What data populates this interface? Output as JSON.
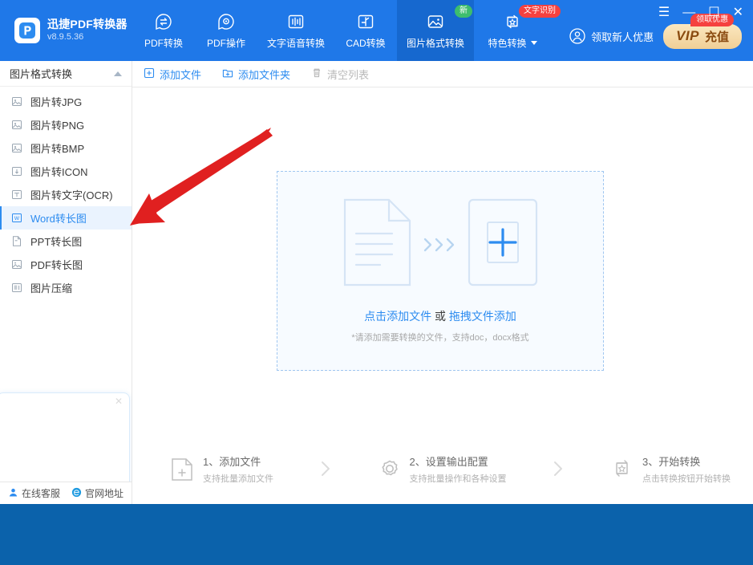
{
  "brand": {
    "title": "迅捷PDF转换器",
    "version": "v8.9.5.36",
    "logo_icon": "p-logo-icon"
  },
  "header": {
    "nav": [
      {
        "label": "PDF转换",
        "icon": "convert-arrows-icon",
        "active": false,
        "badge": null,
        "caret": false
      },
      {
        "label": "PDF操作",
        "icon": "gear-circle-icon",
        "active": false,
        "badge": null,
        "caret": false
      },
      {
        "label": "文字语音转换",
        "icon": "waveform-icon",
        "active": false,
        "badge": null,
        "caret": false
      },
      {
        "label": "CAD转换",
        "icon": "cad-axis-icon",
        "active": false,
        "badge": null,
        "caret": false
      },
      {
        "label": "图片格式转换",
        "icon": "picture-icon",
        "active": true,
        "badge": "新",
        "caret": false
      },
      {
        "label": "特色转换",
        "icon": "star-refresh-icon",
        "active": false,
        "badge": "文字识别",
        "caret": true
      }
    ],
    "promo_label": "领取新人优惠",
    "promo_icon": "user-circle-icon",
    "vip_word": "VIP",
    "vip_label": "充值",
    "vip_badge": "领取优惠",
    "window_controls": {
      "menu": "☰",
      "minimize": "—",
      "maximize": "☐",
      "close": "✕"
    }
  },
  "sidebar": {
    "group_title": "图片格式转换",
    "collapse_icon": "chevron-up-icon",
    "items": [
      {
        "label": "图片转JPG",
        "icon": "image-to-jpg-icon",
        "selected": false
      },
      {
        "label": "图片转PNG",
        "icon": "image-to-png-icon",
        "selected": false
      },
      {
        "label": "图片转BMP",
        "icon": "image-to-bmp-icon",
        "selected": false
      },
      {
        "label": "图片转ICON",
        "icon": "image-to-icon-icon",
        "selected": false
      },
      {
        "label": "图片转文字(OCR)",
        "icon": "text-ocr-icon",
        "selected": false
      },
      {
        "label": "Word转长图",
        "icon": "word-doc-icon",
        "selected": true
      },
      {
        "label": "PPT转长图",
        "icon": "ppt-doc-icon",
        "selected": false
      },
      {
        "label": "PDF转长图",
        "icon": "pdf-image-icon",
        "selected": false
      },
      {
        "label": "图片压缩",
        "icon": "compress-icon",
        "selected": false
      }
    ],
    "promo_card_close": "✕"
  },
  "toolbar": {
    "add_file": "添加文件",
    "add_file_icon": "add-file-icon",
    "add_folder": "添加文件夹",
    "add_folder_icon": "add-folder-icon",
    "clear_list": "清空列表",
    "clear_list_icon": "trash-icon"
  },
  "dropzone": {
    "doc_icon": "document-lines-icon",
    "arrows_icon": "chevrons-right-icon",
    "plus_icon": "plus-box-icon",
    "link_text": "点击添加文件",
    "mid_text": "或",
    "link_text2": "拖拽文件添加",
    "hint": "*请添加需要转换的文件，支持doc，docx格式"
  },
  "steps": [
    {
      "title": "1、添加文件",
      "subtitle": "支持批量添加文件",
      "icon": "add-file-step-icon"
    },
    {
      "title": "2、设置输出配置",
      "subtitle": "支持批量操作和各种设置",
      "icon": "gear-step-icon"
    },
    {
      "title": "3、开始转换",
      "subtitle": "点击转换按钮开始转换",
      "icon": "convert-star-step-icon"
    }
  ],
  "step_separator": "›",
  "statusbar": {
    "service_label": "在线客服",
    "service_icon": "headset-user-icon",
    "website_label": "官网地址",
    "website_icon": "browser-e-icon"
  },
  "annotation": {
    "arrow_icon": "red-arrow-icon",
    "arrow_color": "#e02020"
  },
  "colors": {
    "header_blue": "#1f78e8",
    "active_tab_blue": "#1668cf",
    "desktop_blue": "#0b62ab",
    "accent_blue": "#2d8cf0",
    "selected_bg": "#eaf3fe",
    "dropzone_bg": "#f7fbff",
    "badge_green": "#3dbd6d",
    "badge_red": "#f5413f",
    "vip_gold": "#f0cf96"
  }
}
